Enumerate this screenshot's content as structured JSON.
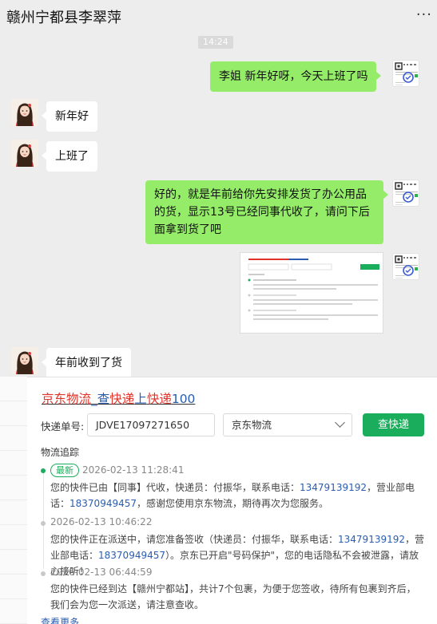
{
  "header": {
    "title": "赣州宁都县李翠萍",
    "more_label": "···"
  },
  "chat": {
    "timestamp": "14:24",
    "messages": [
      {
        "from": "me",
        "text": "李姐  新年好呀，今天上班了吗"
      },
      {
        "from": "them",
        "text": "新年好"
      },
      {
        "from": "them",
        "text": "上班了"
      },
      {
        "from": "me",
        "text": "好的，就是年前给你先安排发货了办公用品的货，显示13号已经同事代收了，请问下后面拿到货了吧"
      },
      {
        "from": "me",
        "type": "image",
        "text": "京东物流_查快递上快递100"
      },
      {
        "from": "them",
        "text": "年前收到了货"
      }
    ]
  },
  "logistics": {
    "title_parts": [
      "京东物流",
      "_查",
      "快递",
      "上",
      "快递",
      "100"
    ],
    "tracking_label": "快递单号:",
    "tracking_number": "JDVE17097271650",
    "carrier": "京东物流",
    "search_button": "查快递",
    "section_title": "物流追踪",
    "latest_badge": "最新",
    "records": [
      {
        "time": "2026-02-13 11:28:41",
        "text_before": "您的快件已由【同事】代收，快递员：付振华，联系电话：",
        "phone1": "13479139192",
        "text_middle": "，营业部电话：",
        "phone2": "18370949457",
        "text_after": "，感谢您使用京东物流，期待再次为您服务。"
      },
      {
        "time": "2026-02-13 10:46:22",
        "text_before": "您的快件正在派送中，请您准备签收（快递员：付振华，联系电话：",
        "phone1": "13479139192",
        "text_middle": "，营业部电话：",
        "phone2": "18370949457",
        "text_after": "）。京东已开启\"号码保护\"，您的电话隐私不会被泄露，请放心接听！"
      },
      {
        "time": "2026-02-13 06:44:59",
        "text": "您的快件已经到达【赣州宁都站】，共计7个包裹，为便于您签收，待所有包裹到齐后，我们会为您一次派送，请注意查收。"
      }
    ],
    "see_more": "查看更多"
  },
  "icons": {
    "avatar_them": "girl-avatar-icon",
    "avatar_me": "qr-avatar-icon"
  },
  "colors": {
    "chat_bg": "#ededed",
    "my_bubble": "#95ec69",
    "their_bubble": "#ffffff",
    "accent_green": "#1aad5b",
    "link_blue": "#2a5db0",
    "brand_red": "#e0342b"
  }
}
